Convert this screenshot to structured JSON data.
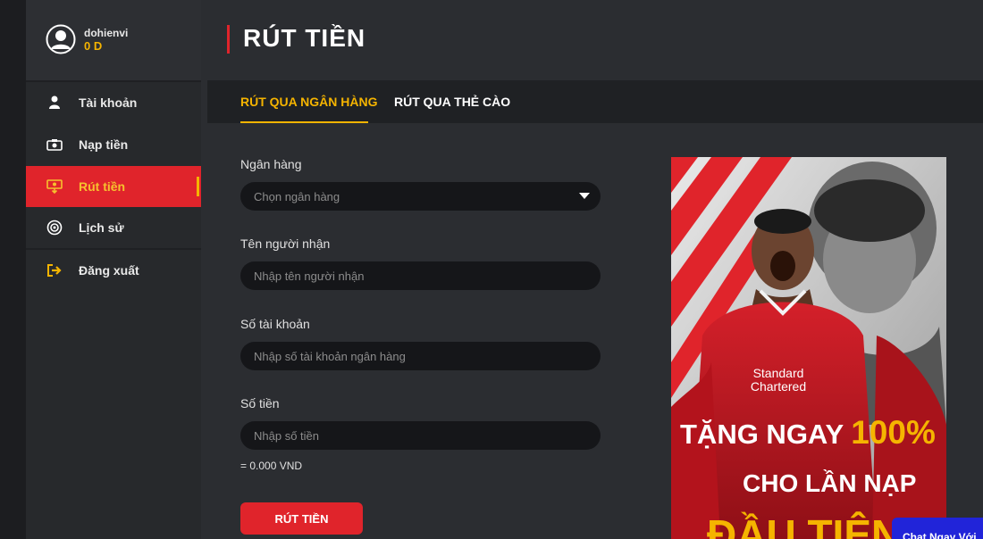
{
  "user": {
    "name": "dohienvi",
    "balance": "0 D"
  },
  "sidebar": {
    "items": [
      {
        "label": "Tài khoản",
        "icon": "user-icon"
      },
      {
        "label": "Nạp tiền",
        "icon": "camera-money-icon"
      },
      {
        "label": "Rút tiền",
        "icon": "withdraw-icon",
        "active": true
      },
      {
        "label": "Lịch sử",
        "icon": "history-icon"
      },
      {
        "label": "Đăng xuất",
        "icon": "logout-icon"
      }
    ]
  },
  "page": {
    "title": "RÚT TIỀN"
  },
  "tabs": [
    {
      "label": "RÚT QUA NGÂN HÀNG",
      "active": true
    },
    {
      "label": "RÚT QUA THẺ CÀO"
    }
  ],
  "form": {
    "bank_label": "Ngân hàng",
    "bank_select": "Chọn ngân hàng",
    "recipient_label": "Tên người nhận",
    "recipient_placeholder": "Nhập tên người nhận",
    "account_label": "Số tài khoản",
    "account_placeholder": "Nhập số tài khoản ngân hàng",
    "amount_label": "Số tiền",
    "amount_placeholder": "Nhập số tiền",
    "amount_note": "= 0.000 VND",
    "submit_label": "RÚT TIỀN"
  },
  "banner": {
    "line1_a": "TẶNG NGAY",
    "line1_b": "100%",
    "line2": "CHO LẦN NẠP",
    "line3": "ĐẦU TIÊN",
    "shirt_text": "Standard Chartered"
  },
  "chat": {
    "label": "Chat Ngay Với"
  },
  "colors": {
    "accent_red": "#e0242b",
    "accent_yellow": "#f5b400",
    "bg": "#2b2d31",
    "sidebar": "#27292c"
  }
}
